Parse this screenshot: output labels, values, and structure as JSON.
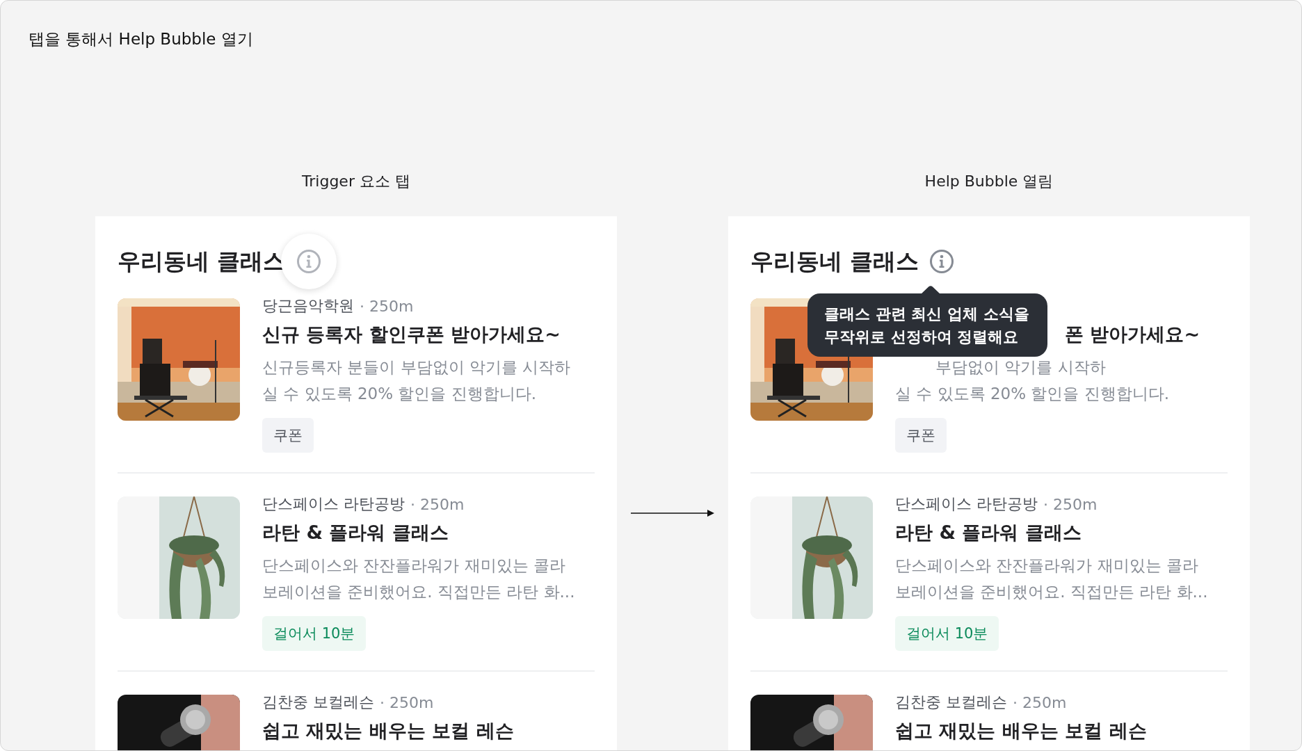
{
  "title": "탭을 통해서 Help Bubble 열기",
  "panels": [
    {
      "caption": "Trigger 요소 탭",
      "heading": "우리동네 클래스",
      "info_pressed": true,
      "items": [
        {
          "shop": "당근음악학원",
          "distance": "· 250m",
          "title": "신규 등록자 할인쿠폰 받아가세요~",
          "description_lines": [
            "신규등록자 분들이 부담없이 악기를 시작하",
            "실 수 있도록 20% 할인을 진행합니다."
          ],
          "tag": {
            "text": "쿠폰",
            "kind": "neutral"
          },
          "covered": false
        },
        {
          "shop": "단스페이스 라탄공방",
          "distance": "· 250m",
          "title": "라탄 & 플라워 클래스",
          "description_lines": [
            "단스페이스와 잔잔플라워가 재미있는 콜라",
            "보레이션을 준비했어요. 직접만든 라탄 화..."
          ],
          "tag": {
            "text": "걸어서 10분",
            "kind": "walk"
          },
          "covered": false
        },
        {
          "shop": "김찬중 보컬레슨",
          "distance": "· 250m",
          "title": "쉽고 재밌는 배우는 보컬 레슨",
          "covered": false
        }
      ]
    },
    {
      "caption": "Help Bubble 열림",
      "heading": "우리동네 클래스",
      "info_pressed": false,
      "help_bubble": {
        "lines": [
          "클래스 관련 최신 업체 소식을",
          "무작위로 선정하여 정렬해요"
        ]
      },
      "items": [
        {
          "title": "폰 받아가세요~",
          "description_lines": [
            "부담없이 악기를 시작하",
            "실 수 있도록 20% 할인을 진행합니다."
          ],
          "tag": {
            "text": "쿠폰",
            "kind": "neutral"
          },
          "covered": true
        },
        {
          "shop": "단스페이스 라탄공방",
          "distance": "· 250m",
          "title": "라탄 & 플라워 클래스",
          "description_lines": [
            "단스페이스와 잔잔플라워가 재미있는 콜라",
            "보레이션을 준비했어요. 직접만든 라탄 화..."
          ],
          "tag": {
            "text": "걸어서 10분",
            "kind": "walk"
          },
          "covered": false
        },
        {
          "shop": "김찬중 보컬레슨",
          "distance": "· 250m",
          "title": "쉽고 재밌는 배우는 보컬 레슨",
          "covered": false
        }
      ]
    }
  ]
}
